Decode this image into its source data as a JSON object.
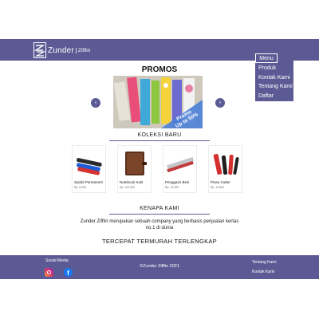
{
  "header": {
    "logo_text": "Zunder",
    "logo_sub": "Zifflin",
    "logo_icon": "zz-logo-icon"
  },
  "menu": {
    "label": "Menu",
    "items": [
      "Produk",
      "Kontak Kami",
      "Tentang Kami",
      "Daftar"
    ]
  },
  "promo": {
    "title": "PROMOS",
    "banner_tag_line1": "Promo",
    "banner_tag_line2": "Up to 50%",
    "prev_label": "«",
    "next_label": "»"
  },
  "collection": {
    "title": "KOLEKSI BARU",
    "products": [
      {
        "name": "Spidol Permanent",
        "price": "Rp. 8.000",
        "icon": "marker-icon"
      },
      {
        "name": "Notebook Kulit",
        "price": "Rp. 124.000",
        "icon": "notebook-icon"
      },
      {
        "name": "Penggaris Besi",
        "price": "Rp. 15.000",
        "icon": "ruler-icon"
      },
      {
        "name": "Pisau Cutter",
        "price": "Rp. 13.500",
        "icon": "cutter-icon"
      }
    ]
  },
  "about": {
    "title": "KENAPA KAMI",
    "text": "Zunder Zifflin merupakan sebuah company yang berbasis penjualan kertas no.1 di dunia",
    "slogan": "TERCEPAT TERMURAH TERLENGKAP"
  },
  "footer": {
    "social_label": "Sosial Media",
    "social_icons": [
      "instagram-icon",
      "facebook-icon"
    ],
    "facebook_glyph": "f",
    "copyright": "©Zunder Zifflin 2021",
    "links": [
      "Tentang Kami",
      "Kontak Kami"
    ]
  },
  "colors": {
    "brand": "#5c5a94",
    "background": "#ffffff",
    "text": "#222222"
  }
}
